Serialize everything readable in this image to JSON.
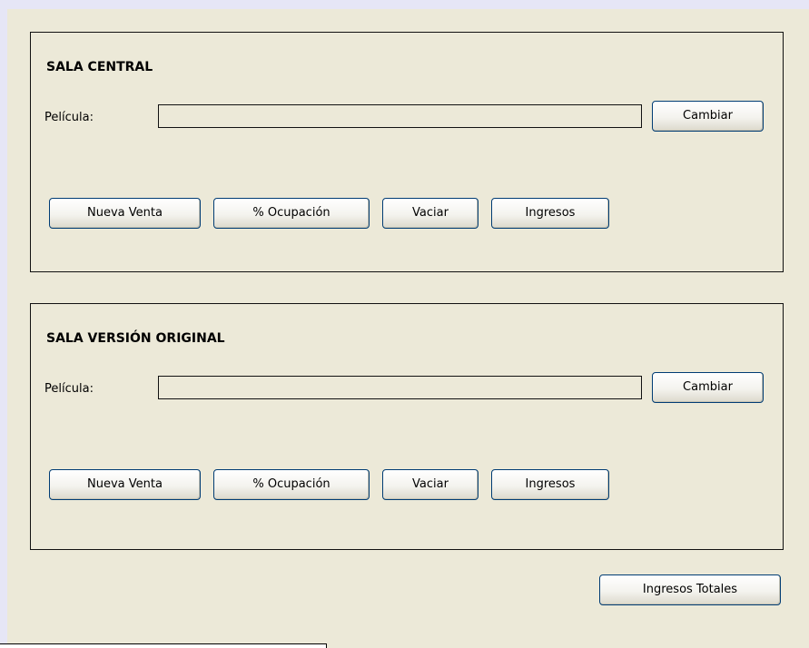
{
  "sala_central": {
    "title": "SALA CENTRAL",
    "pelicula_label": "Película:",
    "pelicula_value": "",
    "cambiar_label": "Cambiar",
    "nueva_venta_label": "Nueva Venta",
    "ocupacion_label": "% Ocupación",
    "vaciar_label": "Vaciar",
    "ingresos_label": "Ingresos"
  },
  "sala_vo": {
    "title": "SALA VERSIÓN ORIGINAL",
    "pelicula_label": "Película:",
    "pelicula_value": "",
    "cambiar_label": "Cambiar",
    "nueva_venta_label": "Nueva Venta",
    "ocupacion_label": "% Ocupación",
    "vaciar_label": "Vaciar",
    "ingresos_label": "Ingresos"
  },
  "footer": {
    "ingresos_totales_label": "Ingresos Totales"
  },
  "colors": {
    "window_background": "#ece9d8",
    "button_border": "#003c74",
    "outer_background": "#e6e6f6"
  }
}
